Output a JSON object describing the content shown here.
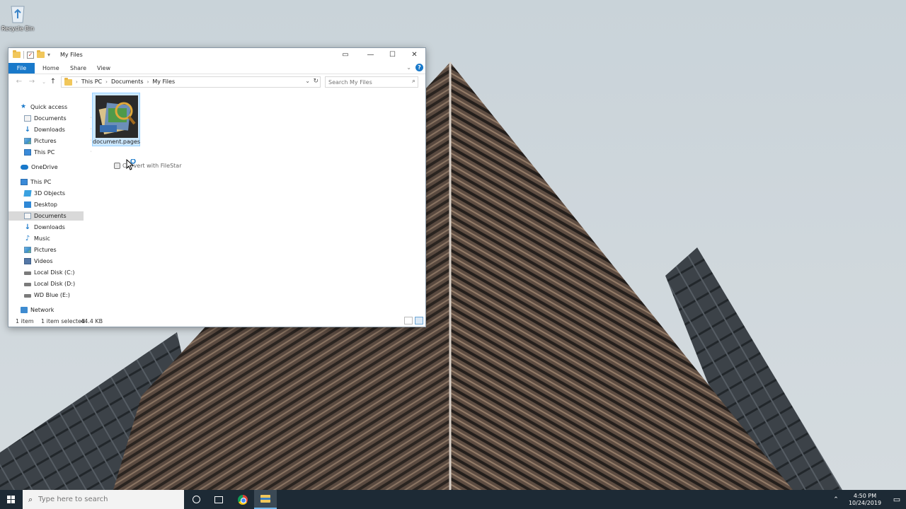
{
  "desktop": {
    "recycle_bin_label": "Recycle Bin"
  },
  "window": {
    "title": "My Files",
    "controls": {
      "minimize": "—",
      "maximize": "☐",
      "close": "✕"
    },
    "ribbon": {
      "tabs": [
        "File",
        "Home",
        "Share",
        "View"
      ]
    },
    "address": {
      "crumbs": [
        "This PC",
        "Documents",
        "My Files"
      ]
    },
    "search": {
      "placeholder": "Search My Files"
    },
    "nav": {
      "items": [
        {
          "label": "Quick access",
          "icon": "star-icon",
          "pinned": false
        },
        {
          "label": "Documents",
          "icon": "documents-icon",
          "pinned": true
        },
        {
          "label": "Downloads",
          "icon": "downloads-icon",
          "pinned": true
        },
        {
          "label": "Pictures",
          "icon": "pictures-icon",
          "pinned": true
        },
        {
          "label": "This PC",
          "icon": "this-pc-icon",
          "pinned": true
        },
        {
          "label": "OneDrive",
          "icon": "cloud-icon",
          "pinned": false
        },
        {
          "label": "This PC",
          "icon": "this-pc-icon",
          "pinned": false
        },
        {
          "label": "3D Objects",
          "icon": "cube-icon",
          "pinned": false
        },
        {
          "label": "Desktop",
          "icon": "desktop-icon",
          "pinned": false
        },
        {
          "label": "Documents",
          "icon": "documents-icon",
          "pinned": false,
          "selected": true
        },
        {
          "label": "Downloads",
          "icon": "downloads-icon",
          "pinned": false
        },
        {
          "label": "Music",
          "icon": "music-icon",
          "pinned": false
        },
        {
          "label": "Pictures",
          "icon": "pictures-icon",
          "pinned": false
        },
        {
          "label": "Videos",
          "icon": "videos-icon",
          "pinned": false
        },
        {
          "label": "Local Disk (C:)",
          "icon": "disk-icon",
          "pinned": false
        },
        {
          "label": "Local Disk (D:)",
          "icon": "disk-icon",
          "pinned": false
        },
        {
          "label": "WD Blue (E:)",
          "icon": "disk-icon",
          "pinned": false
        },
        {
          "label": "Network",
          "icon": "network-icon",
          "pinned": false
        }
      ]
    },
    "content": {
      "file_name": "document.pages",
      "context_hint": "Convert with FileStar"
    },
    "status": {
      "count": "1 item",
      "selected": "1 item selected",
      "size": "44.4 KB"
    }
  },
  "taskbar": {
    "search_placeholder": "Type here to search",
    "clock_time": "4:50 PM",
    "clock_date": "10/24/2019"
  },
  "colors": {
    "accent": "#1979ca",
    "selection": "#cce8ff",
    "taskbar": "#1d2a35"
  }
}
